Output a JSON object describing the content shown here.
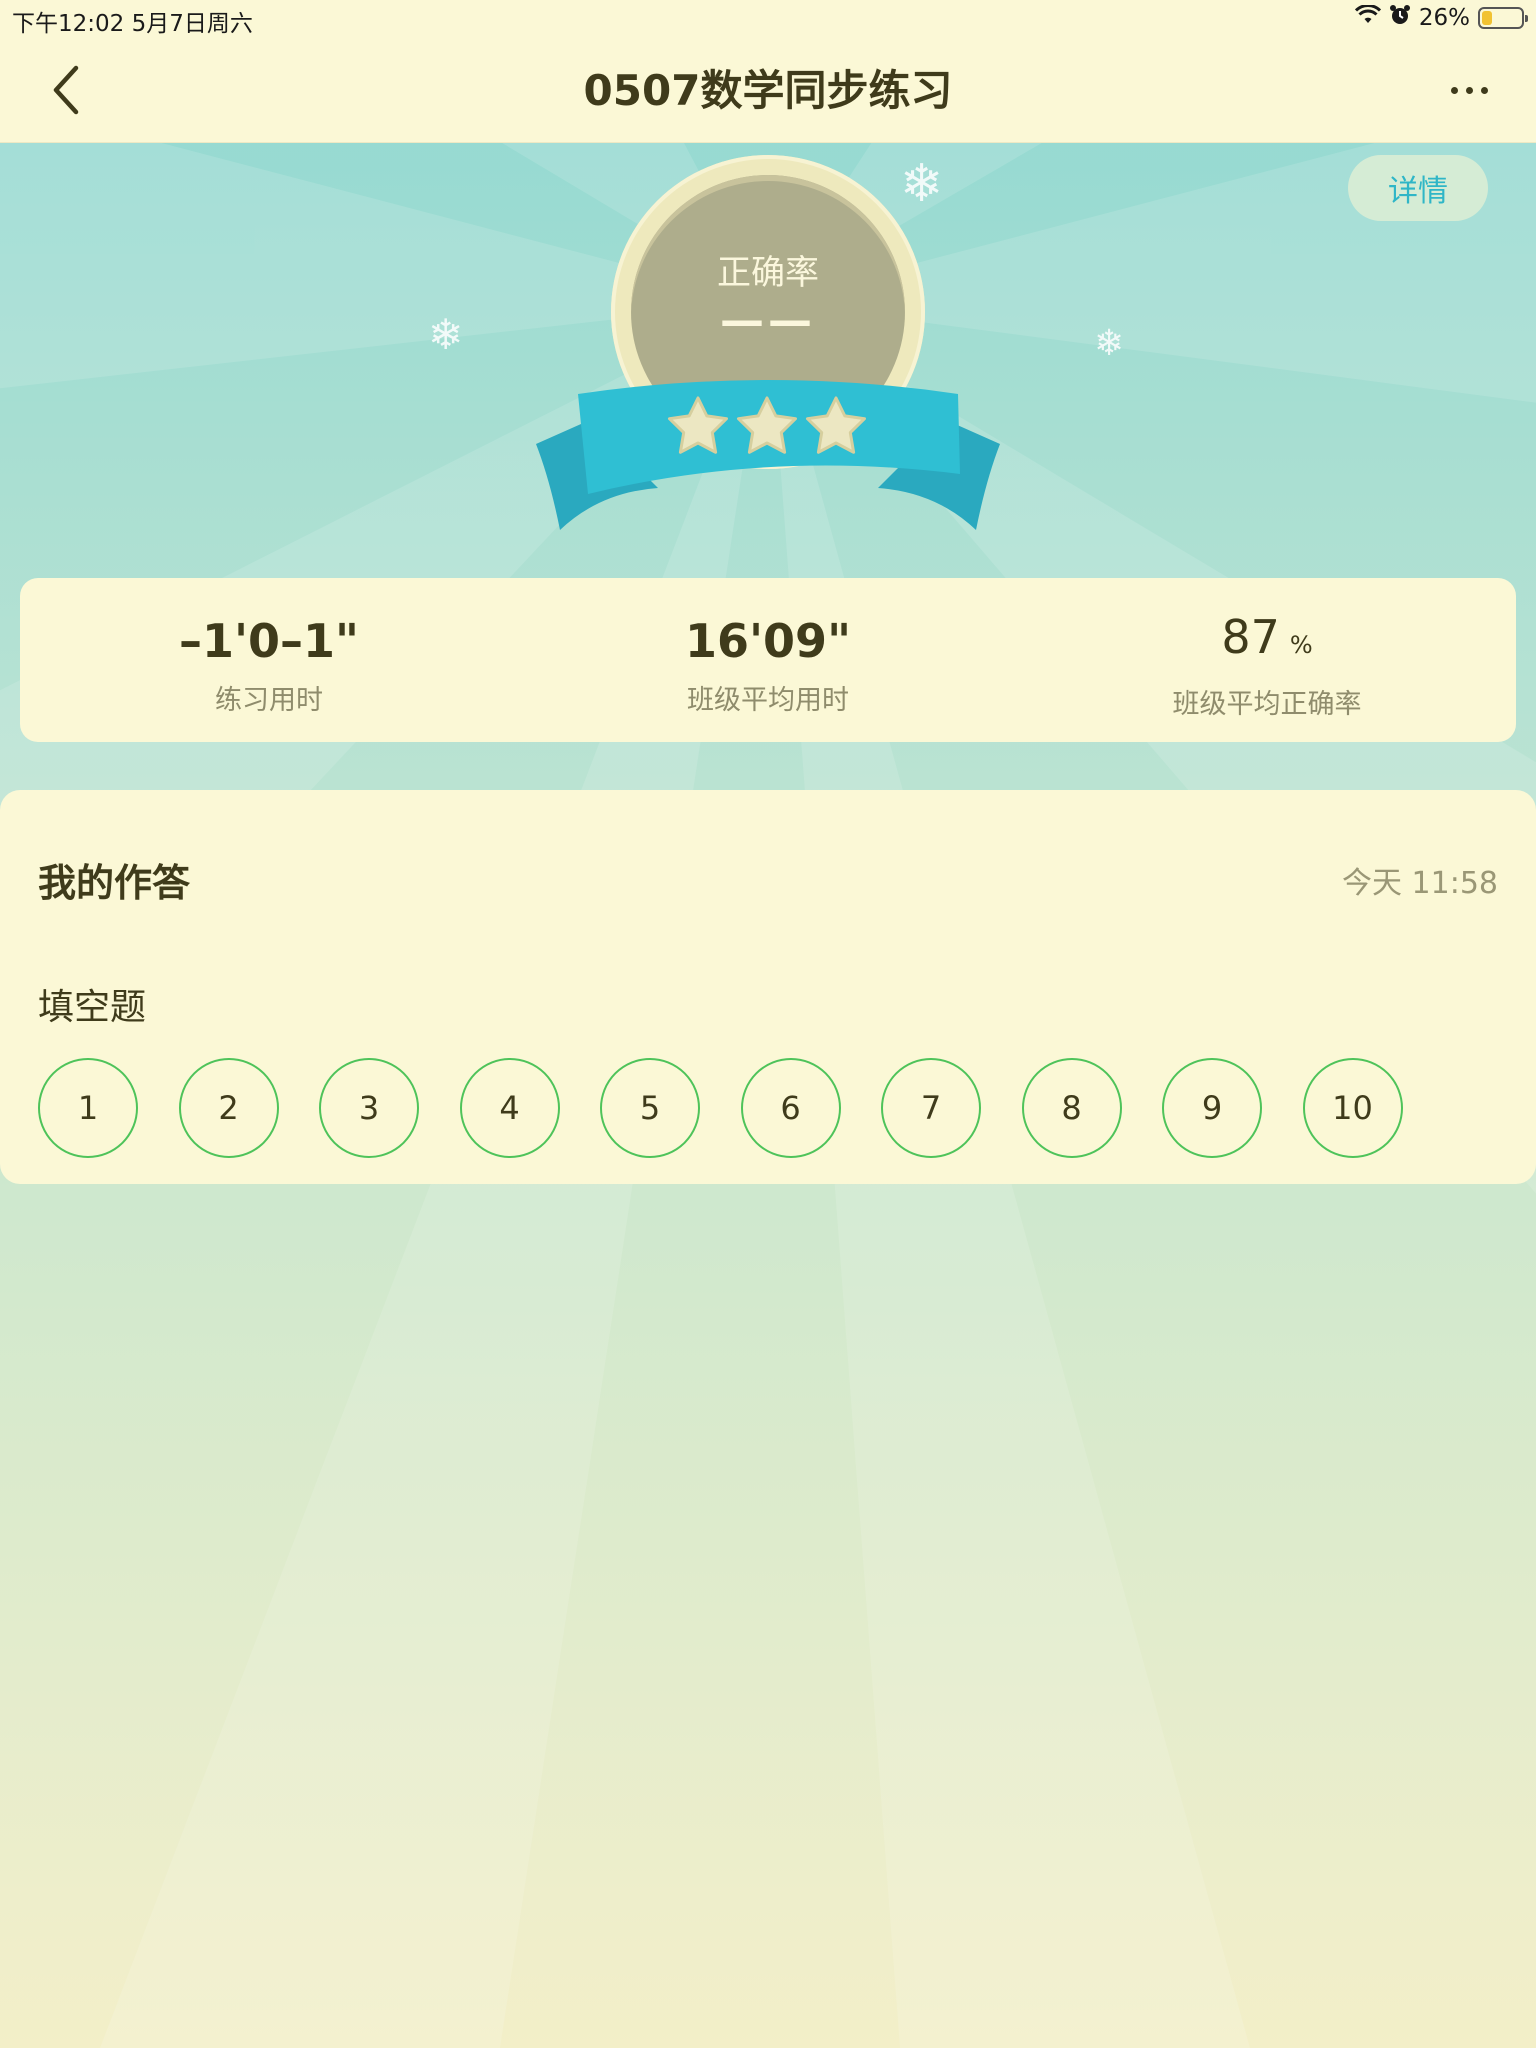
{
  "status_bar": {
    "time_date": "下午12:02   5月7日周六",
    "battery_text": "26%",
    "battery_level": 0.26,
    "battery_color": "#f1c232"
  },
  "nav": {
    "title": "0507数学同步练习",
    "back_icon": "chevron-left-icon",
    "more_icon": "more-horizontal-icon"
  },
  "hero": {
    "details_label": "详情",
    "medal_label": "正确率",
    "medal_value": "——",
    "stars": 3
  },
  "stats": [
    {
      "value": "–1'0–1\"",
      "label": "练习用时"
    },
    {
      "value": "16'09\"",
      "label": "班级平均用时"
    },
    {
      "value": "87",
      "unit": "%",
      "label": "班级平均正确率"
    }
  ],
  "answers": {
    "title": "我的作答",
    "time": "今天 11:58",
    "section_label": "填空题",
    "questions": [
      "1",
      "2",
      "3",
      "4",
      "5",
      "6",
      "7",
      "8",
      "9",
      "10"
    ]
  },
  "colors": {
    "accent_teal": "#2fb6c7",
    "ribbon": "#2fbfd3",
    "answered_green": "#4ec35a",
    "card_bg": "#fbf8d6"
  }
}
